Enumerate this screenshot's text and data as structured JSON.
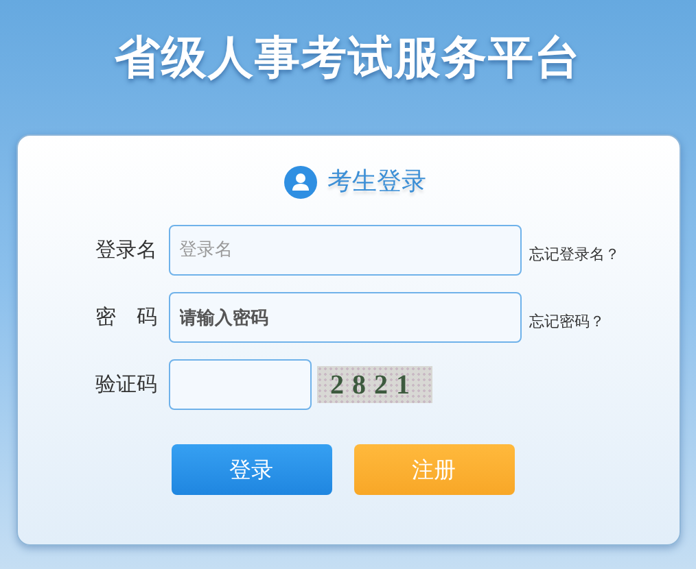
{
  "title": "省级人事考试服务平台",
  "login": {
    "heading": "考生登录",
    "fields": [
      {
        "label": "登录名",
        "placeholder": "登录名",
        "link": "忘记登录名？"
      },
      {
        "label": "密　码",
        "value": "请输入密码",
        "link": "忘记密码？"
      }
    ],
    "captcha": {
      "label": "验证码",
      "code": "2821"
    },
    "buttons": [
      {
        "label": "登录",
        "kind": "primary"
      },
      {
        "label": "注册",
        "kind": "secondary"
      }
    ]
  }
}
